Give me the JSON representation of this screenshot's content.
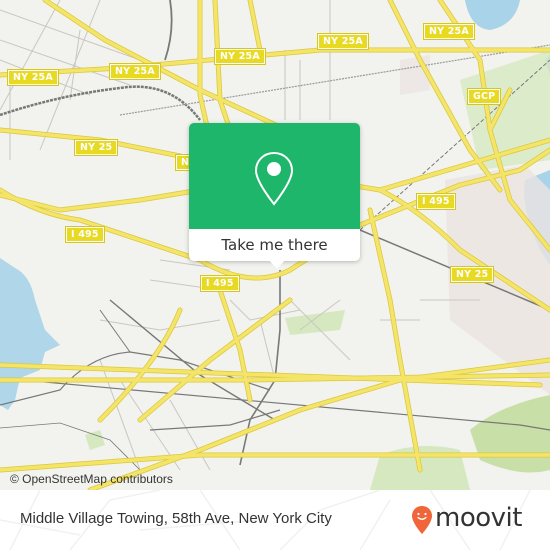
{
  "map": {
    "colors": {
      "background": "#f2f2ee",
      "road_major": "#f5e46a",
      "road_casing": "#d9c93a",
      "road_minor": "#c9c7c0",
      "rail": "#777777",
      "water": "#a9d3e8",
      "park": "#d6e8bf",
      "industrial": "#ebe4e1"
    },
    "shields": [
      {
        "id": "ny25a-1",
        "label": "NY 25A"
      },
      {
        "id": "ny25a-2",
        "label": "NY 25A"
      },
      {
        "id": "ny25a-3",
        "label": "NY 25A"
      },
      {
        "id": "ny25a-4",
        "label": "NY 25A"
      },
      {
        "id": "ny25a-5",
        "label": "NY 25A"
      },
      {
        "id": "ny25-1",
        "label": "NY 25"
      },
      {
        "id": "ny-partial",
        "label": "N"
      },
      {
        "id": "gcp",
        "label": "GCP"
      },
      {
        "id": "i495-1",
        "label": "I 495"
      },
      {
        "id": "i495-2",
        "label": "I 495"
      },
      {
        "id": "i495-3",
        "label": "I 495"
      },
      {
        "id": "ny25-2",
        "label": "NY 25"
      }
    ],
    "attribution": "© OpenStreetMap contributors"
  },
  "popup": {
    "icon": "map-pin-icon",
    "accent": "#1db66a",
    "button_label": "Take me there"
  },
  "footer": {
    "place_title": "Middle Village Towing, 58th Ave, New York City",
    "brand": {
      "name": "moovit",
      "icon": "moovit-pin-logo-icon",
      "color": "#f0663a"
    }
  }
}
